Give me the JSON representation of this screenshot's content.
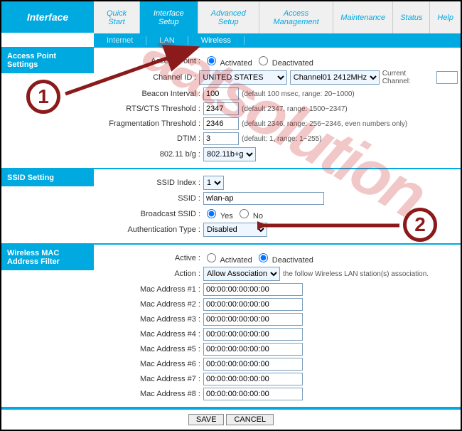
{
  "title": "Interface",
  "tabs": [
    "Quick Start",
    "Interface Setup",
    "Advanced Setup",
    "Access Management",
    "Maintenance",
    "Status",
    "Help"
  ],
  "active_tab": 1,
  "subtabs": [
    "Internet",
    "LAN",
    "Wireless"
  ],
  "active_subtab": 2,
  "sections": {
    "ap": "Access Point Settings",
    "ssid": "SSID Setting",
    "mac": "Wireless MAC Address Filter"
  },
  "ap": {
    "access_point_label": "Access Point :",
    "activated": "Activated",
    "deactivated": "Deactivated",
    "channel_id_label": "Channel ID :",
    "country": "UNITED STATES",
    "channel": "Channel01 2412MHz",
    "current_channel_label": "Current Channel:",
    "current_channel": "",
    "beacon_label": "Beacon Interval :",
    "beacon": "100",
    "beacon_hint": "(default 100 msec, range: 20~1000)",
    "rts_label": "RTS/CTS Threshold :",
    "rts": "2347",
    "rts_hint": "(default 2347, range: 1500~2347)",
    "frag_label": "Fragmentation Threshold :",
    "frag": "2346",
    "frag_hint": "(default 2346, range: 256~2346, even numbers only)",
    "dtim_label": "DTIM :",
    "dtim": "3",
    "dtim_hint": "(default: 1, range: 1~255)",
    "mode_label": "802.11 b/g :",
    "mode": "802.11b+g"
  },
  "ssid": {
    "index_label": "SSID Index :",
    "index": "1",
    "ssid_label": "SSID :",
    "ssid": "wlan-ap",
    "broadcast_label": "Broadcast SSID :",
    "yes": "Yes",
    "no": "No",
    "auth_label": "Authentication Type :",
    "auth": "Disabled"
  },
  "mac": {
    "active_label": "Active :",
    "activated": "Activated",
    "deactivated": "Deactivated",
    "action_label": "Action :",
    "action": "Allow Association",
    "action_hint": "the follow Wireless LAN station(s) association.",
    "addr_labels": [
      "Mac Address #1 :",
      "Mac Address #2 :",
      "Mac Address #3 :",
      "Mac Address #4 :",
      "Mac Address #5 :",
      "Mac Address #6 :",
      "Mac Address #7 :",
      "Mac Address #8 :"
    ],
    "addr": "00:00:00:00:00:00"
  },
  "footer": {
    "save": "SAVE",
    "cancel": "CANCEL"
  },
  "watermark": "aatsolution",
  "callouts": {
    "one": "1",
    "two": "2"
  }
}
